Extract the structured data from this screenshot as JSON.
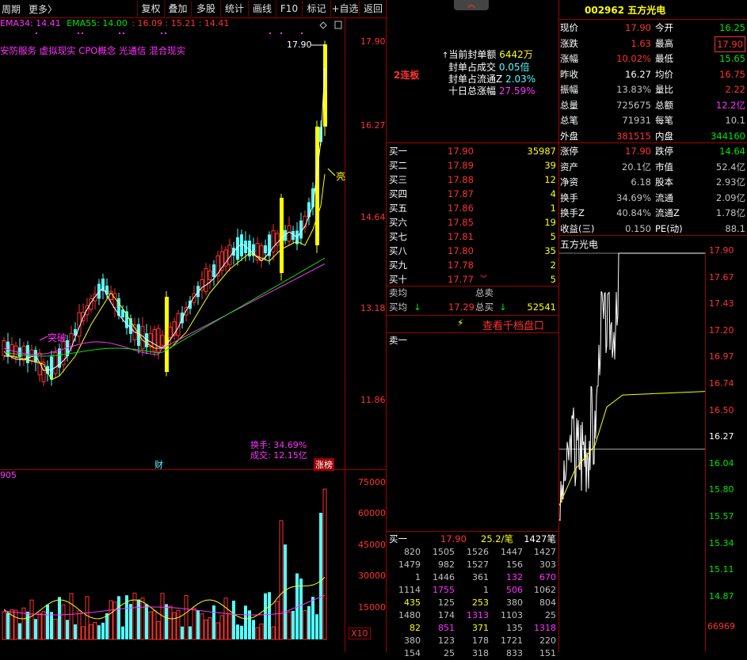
{
  "toolbar": {
    "period_label": "周期",
    "more_label": "更多〉",
    "buttons": [
      "复权",
      "叠加",
      "多股",
      "统计",
      "画线",
      "F10",
      "标记",
      "+自选",
      "返回"
    ]
  },
  "chart": {
    "ema_partial_label": "EMA34: 14.41",
    "ema55_label": "EMA55: 14.00",
    "ema_values": ": 16.09 : 15.21 : 14.41",
    "concepts_text": "安防服务 虚拟现实 CPO概念 光通信 混合现实",
    "peak_label": "17.90",
    "price_ticks": [
      "17.90",
      "16.27",
      "14.64",
      "13.18",
      "11.86"
    ],
    "annot_liang": "亮",
    "annot_tuwei": "突破",
    "turnover_label": "换手: 34.69%",
    "volume_label": "成交: 12.15亿",
    "cai_tag": "财",
    "zhangbang_tag": "涨榜",
    "vol_indicator_label": "905",
    "vol_ticks": [
      "75000",
      "60000",
      "45000",
      "30000",
      "15000"
    ],
    "x10_label": "X10",
    "colors": {
      "up": "#ff3232",
      "down": "#54ffff",
      "limit": "#ffff00",
      "ema_a": "#ffffff",
      "ema_b": "#ffff00",
      "ema_c": "#ff32ff",
      "ema_d": "#00e600"
    }
  },
  "middle": {
    "board_label": "2连板",
    "seal_amount_label": "当前封单额",
    "seal_amount_value": "6442万",
    "seal_ratio_vol_label": "封单占成交",
    "seal_ratio_vol_value": "0.05倍",
    "seal_ratio_float_label": "封单占流通Z",
    "seal_ratio_float_value": "2.03%",
    "ten_day_label": "十日总涨幅",
    "ten_day_value": "27.59%",
    "bids": [
      {
        "label": "买一",
        "price": "17.90",
        "vol": "35987"
      },
      {
        "label": "买二",
        "price": "17.89",
        "vol": "39"
      },
      {
        "label": "买三",
        "price": "17.88",
        "vol": "12"
      },
      {
        "label": "买四",
        "price": "17.87",
        "vol": "4"
      },
      {
        "label": "买五",
        "price": "17.86",
        "vol": "1"
      },
      {
        "label": "买六",
        "price": "17.85",
        "vol": "19"
      },
      {
        "label": "买七",
        "price": "17.81",
        "vol": "5"
      },
      {
        "label": "买八",
        "price": "17.80",
        "vol": "35"
      },
      {
        "label": "买九",
        "price": "17.78",
        "vol": "2"
      },
      {
        "label": "买十",
        "price": "17.77",
        "vol": "5"
      }
    ],
    "sell_avg_label": "卖均",
    "total_sell_label": "总卖",
    "buy_avg_label": "买均",
    "buy_avg_value": "17.29",
    "total_buy_label": "总买",
    "total_buy_value": "52541",
    "thousand_levels_label": "查看千档盘口",
    "sell_one_label": "卖一",
    "queue_header": {
      "label": "买一",
      "price": "17.90",
      "avg": "25.2/笔",
      "count": "1427笔"
    },
    "queue_rows": [
      [
        "820",
        "1505",
        "1526",
        "1447",
        "1427"
      ],
      [
        "1479",
        "982",
        "1527",
        "156",
        "303"
      ],
      [
        "1",
        "1446",
        "361",
        "132",
        "670"
      ],
      [
        "1114",
        "1755",
        "1",
        "506",
        "1062"
      ],
      [
        "435",
        "125",
        "253",
        "380",
        "804"
      ],
      [
        "1480",
        "174",
        "1313",
        "1103",
        "25"
      ],
      [
        "82",
        "851",
        "371",
        "135",
        "1318"
      ],
      [
        "380",
        "123",
        "178",
        "1721",
        "220"
      ],
      [
        "154",
        "25",
        "318",
        "833",
        "151"
      ]
    ]
  },
  "quote": {
    "code_name": "002962 五方光电",
    "rows": [
      {
        "l1": "现价",
        "v1": "17.90",
        "c1": "red",
        "l2": "今开",
        "v2": "16.25",
        "c2": "green"
      },
      {
        "l1": "涨跌",
        "v1": "1.63",
        "c1": "red",
        "l2": "最高",
        "v2": "17.90",
        "c2": "red-box"
      },
      {
        "l1": "涨幅",
        "v1": "10.02%",
        "c1": "red",
        "l2": "最低",
        "v2": "15.65",
        "c2": "green"
      },
      {
        "l1": "昨收",
        "v1": "16.27",
        "c1": "white",
        "l2": "均价",
        "v2": "16.75",
        "c2": "red"
      },
      {
        "l1": "振幅",
        "v1": "13.83%",
        "c1": "gray",
        "l2": "量比",
        "v2": "2.22",
        "c2": "red"
      },
      {
        "l1": "总量",
        "v1": "725675",
        "c1": "gray",
        "l2": "总额",
        "v2": "12.2亿",
        "c2": "magenta"
      },
      {
        "l1": "总笔",
        "v1": "71931",
        "c1": "gray",
        "l2": "每笔",
        "v2": "10.1",
        "c2": "gray"
      },
      {
        "l1": "外盘",
        "v1": "381515",
        "c1": "red",
        "l2": "内盘",
        "v2": "344160",
        "c2": "green"
      }
    ],
    "rows2": [
      {
        "l1": "涨停",
        "v1": "17.90",
        "c1": "red",
        "l2": "跌停",
        "v2": "14.64",
        "c2": "green"
      },
      {
        "l1": "资产",
        "v1": "20.1亿",
        "c1": "gray",
        "l2": "市值",
        "v2": "52.4亿",
        "c2": "gray"
      },
      {
        "l1": "净资",
        "v1": "6.18",
        "c1": "gray",
        "l2": "股本",
        "v2": "2.93亿",
        "c2": "gray"
      },
      {
        "l1": "换手",
        "v1": "34.69%",
        "c1": "gray",
        "l2": "流通",
        "v2": "2.09亿",
        "c2": "gray"
      },
      {
        "l1": "换手Z",
        "v1": "40.84%",
        "c1": "gray",
        "l2": "流通Z",
        "v2": "1.78亿",
        "c2": "gray"
      },
      {
        "l1": "收益(三)",
        "v1": "0.150",
        "c1": "gray",
        "l2": "PE(动)",
        "v2": "88.1",
        "c2": "gray"
      }
    ]
  },
  "intraday": {
    "title": "五方光电",
    "ticks": [
      {
        "v": "17.90",
        "c": "red"
      },
      {
        "v": "17.67",
        "c": "red"
      },
      {
        "v": "17.43",
        "c": "red"
      },
      {
        "v": "17.20",
        "c": "red"
      },
      {
        "v": "16.97",
        "c": "red"
      },
      {
        "v": "16.74",
        "c": "red"
      },
      {
        "v": "16.50",
        "c": "red"
      },
      {
        "v": "16.27",
        "c": "white"
      },
      {
        "v": "16.04",
        "c": "green"
      },
      {
        "v": "15.80",
        "c": "green"
      },
      {
        "v": "15.57",
        "c": "green"
      },
      {
        "v": "15.34",
        "c": "green"
      },
      {
        "v": "15.11",
        "c": "green"
      },
      {
        "v": "14.87",
        "c": "green"
      }
    ],
    "volume_value": "66969"
  }
}
